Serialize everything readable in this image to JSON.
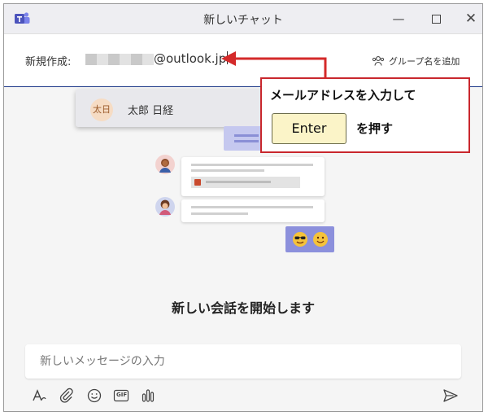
{
  "window": {
    "title": "新しいチャット",
    "minimize_label": "—",
    "close_label": "✕"
  },
  "to_row": {
    "label": "新規作成:",
    "email_visible": "@outlook.jp",
    "add_group_label": "グループ名を追加"
  },
  "suggestion": {
    "avatar_initials": "太日",
    "name": "太郎 日経"
  },
  "callout": {
    "line1": "メールアドレスを入力して",
    "key_label": "Enter",
    "line2": "を押す"
  },
  "conversation": {
    "start_text": "新しい会話を開始します"
  },
  "compose": {
    "placeholder": "新しいメッセージの入力",
    "gif_label": "GIF"
  },
  "colors": {
    "accent": "#1f3a8a",
    "callout_border": "#c9272d",
    "arrow": "#d42a2a",
    "key_fill": "#fbf4c8"
  }
}
